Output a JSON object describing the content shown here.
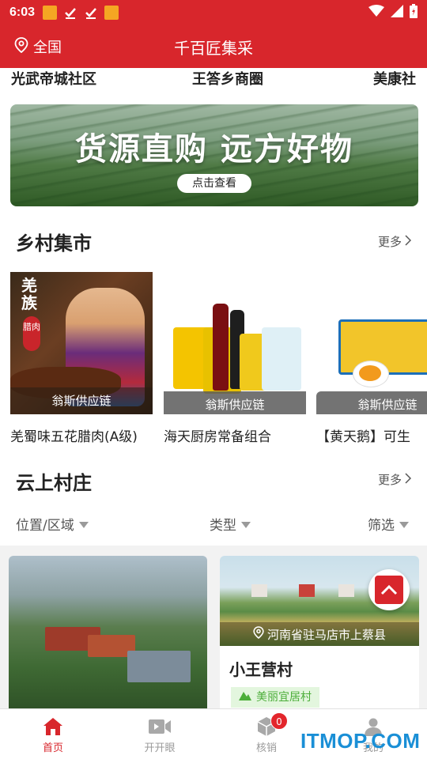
{
  "status_bar": {
    "time": "6:03"
  },
  "header": {
    "location": "全国",
    "title": "千百匠集采"
  },
  "communities": [
    "光武帝城社区",
    "王答乡商圈",
    "美康社"
  ],
  "banner": {
    "headline": "货源直购 远方好物",
    "cta": "点击查看"
  },
  "rural_market": {
    "title": "乡村集市",
    "more": "更多",
    "products": [
      {
        "badge": "羌族",
        "badge2": "腊肉",
        "tag": "翁斯供应链",
        "name": "羌蜀味五花腊肉(A级)"
      },
      {
        "tag": "翁斯供应链",
        "name": "海天厨房常备组合"
      },
      {
        "tag": "翁斯供应链",
        "name": "【黄天鹅】可生"
      }
    ]
  },
  "cloud_villages": {
    "title": "云上村庄",
    "more": "更多",
    "filters": [
      "位置/区域",
      "类型",
      "筛选"
    ],
    "cards": [
      {
        "location": "河南省驻马店市上蔡县",
        "name": "小王营村",
        "tag": "美丽宜居村"
      }
    ]
  },
  "tabbar": {
    "items": [
      {
        "label": "首页",
        "active": true
      },
      {
        "label": "开开眼",
        "active": false
      },
      {
        "label": "核销",
        "active": false,
        "badge": "0"
      },
      {
        "label": "我的",
        "active": false
      }
    ]
  },
  "watermark": "ITMOP.COM",
  "colors": {
    "brand_red": "#d8262c",
    "tag_green": "#4cae3a"
  }
}
